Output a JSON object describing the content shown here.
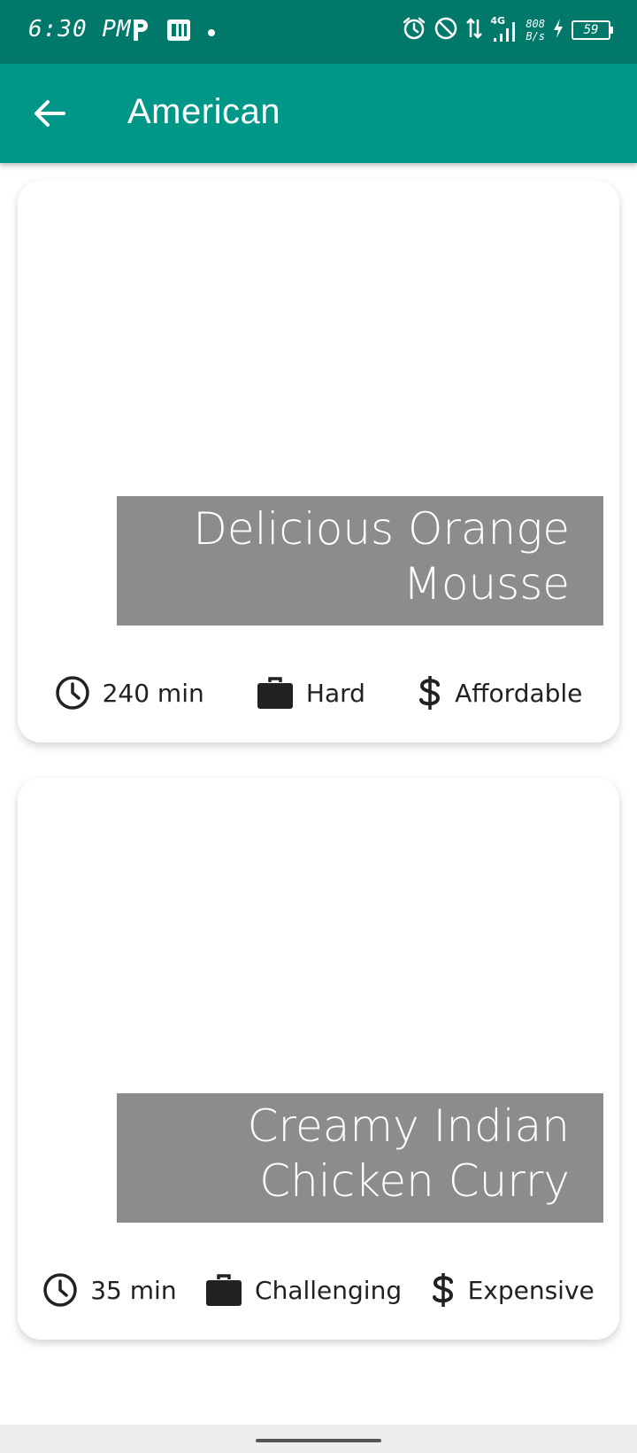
{
  "status_bar": {
    "time": "6:30 PM",
    "net_speed_value": "808",
    "net_speed_unit": "B/s",
    "network_type": "4G",
    "battery_level": "59",
    "icons": [
      "parking-icon",
      "app-notification-icon",
      "dot-icon",
      "alarm-icon",
      "do-not-disturb-icon",
      "data-transfer-icon",
      "signal-icon",
      "charging-icon",
      "battery-icon"
    ]
  },
  "app_bar": {
    "title": "American",
    "background_color": "#009688",
    "status_color": "#00796b"
  },
  "meals": [
    {
      "title_line1": "Delicious Orange",
      "title_line2": "Mousse",
      "duration": "240 min",
      "complexity": "Hard",
      "affordability": "Affordable"
    },
    {
      "title_line1": "Creamy Indian",
      "title_line2": "Chicken Curry",
      "duration": "35 min",
      "complexity": "Challenging",
      "affordability": "Expensive"
    }
  ]
}
